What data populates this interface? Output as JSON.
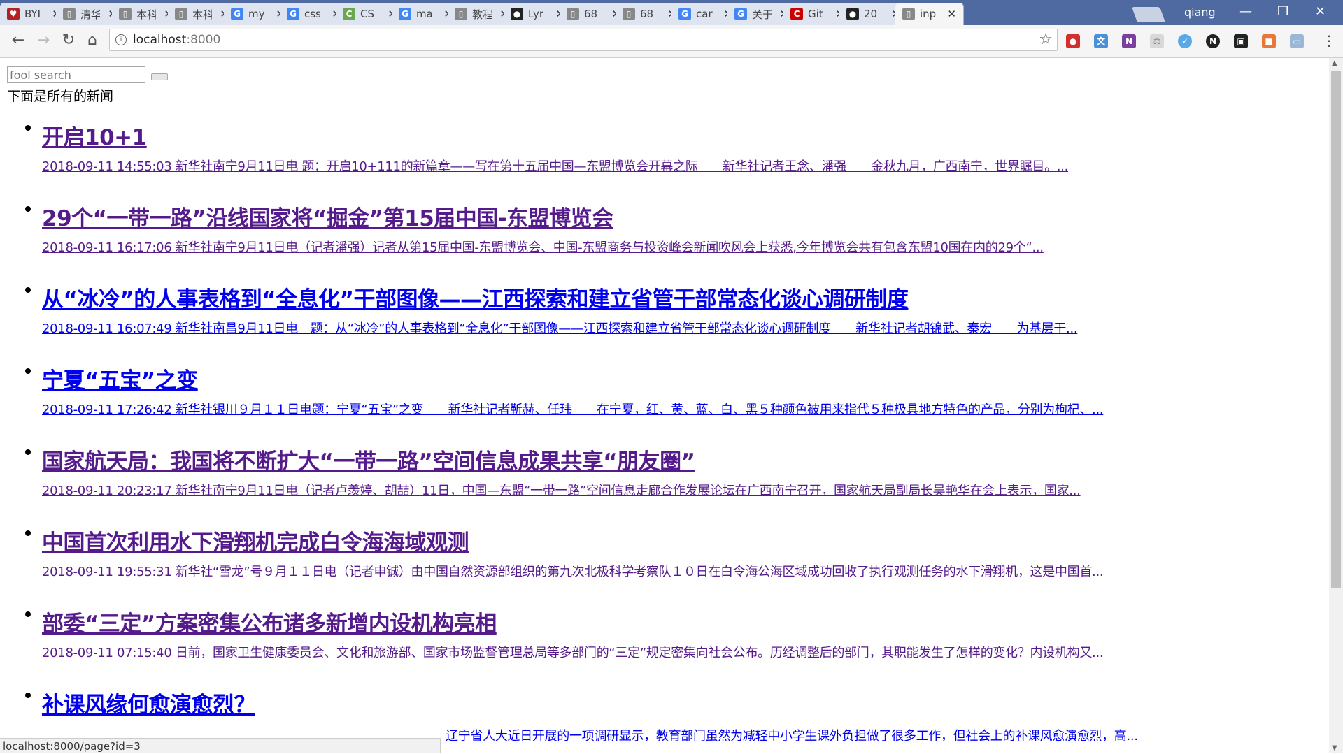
{
  "tabs": [
    {
      "label": "BYI",
      "icon": "bird-icon",
      "color": "#b22222"
    },
    {
      "label": "清华",
      "icon": "page-icon",
      "color": "#888888"
    },
    {
      "label": "本科",
      "icon": "page-icon",
      "color": "#888888"
    },
    {
      "label": "本科",
      "icon": "page-icon",
      "color": "#888888"
    },
    {
      "label": "my",
      "icon": "google-icon",
      "color": "#4285f4"
    },
    {
      "label": "css",
      "icon": "google-icon",
      "color": "#4285f4"
    },
    {
      "label": "CS",
      "icon": "csdn-icon",
      "color": "#6aa84f"
    },
    {
      "label": "ma",
      "icon": "google-icon",
      "color": "#4285f4"
    },
    {
      "label": "教程",
      "icon": "page-icon",
      "color": "#888888"
    },
    {
      "label": "Lyr",
      "icon": "github-icon",
      "color": "#222222"
    },
    {
      "label": "68",
      "icon": "page-icon",
      "color": "#888888"
    },
    {
      "label": "68",
      "icon": "page-icon",
      "color": "#888888"
    },
    {
      "label": "car",
      "icon": "google-icon",
      "color": "#4285f4"
    },
    {
      "label": "关于",
      "icon": "google-icon",
      "color": "#4285f4"
    },
    {
      "label": "Git",
      "icon": "c-icon",
      "color": "#cc0000"
    },
    {
      "label": "20",
      "icon": "github-icon",
      "color": "#222222"
    },
    {
      "label": "inp",
      "icon": "page-icon",
      "color": "#888888"
    }
  ],
  "user_name": "qiang",
  "address": {
    "host": "localhost",
    "port": ":8000"
  },
  "search": {
    "placeholder": "fool search"
  },
  "intro": "下面是所有的新闻",
  "news": [
    {
      "title": "开启10+1",
      "summary": "2018-09-11 14:55:03 新华社南宁9月11日电 题：开启10+111的新篇章——写在第十五届中国—东盟博览会开幕之际　　新华社记者王念、潘强　　金秋九月，广西南宁，世界瞩目。...",
      "visited": true
    },
    {
      "title": "29个“一带一路”沿线国家将“掘金”第15届中国-东盟博览会",
      "summary": "2018-09-11 16:17:06 新华社南宁9月11日电（记者潘强）记者从第15届中国-东盟博览会、中国-东盟商务与投资峰会新闻吹风会上获悉,今年博览会共有包含东盟10国在内的29个“...",
      "visited": true
    },
    {
      "title": "从“冰冷”的人事表格到“全息化”干部图像——江西探索和建立省管干部常态化谈心调研制度",
      "summary": "2018-09-11 16:07:49 新华社南昌9月11日电　题：从“冰冷”的人事表格到“全息化”干部图像——江西探索和建立省管干部常态化谈心调研制度　　新华社记者胡锦武、秦宏　　为基层干...",
      "visited": false
    },
    {
      "title": "宁夏“五宝”之变",
      "summary": "2018-09-11 17:26:42 新华社银川９月１１日电题：宁夏“五宝”之变　　新华社记者靳赫、任玮　　在宁夏，红、黄、蓝、白、黑５种颜色被用来指代５种极具地方特色的产品，分别为枸杞、...",
      "visited": false
    },
    {
      "title": "国家航天局：我国将不断扩大“一带一路”空间信息成果共享“朋友圈”",
      "summary": "2018-09-11 20:23:17 新华社南宁9月11日电（记者卢羡婷、胡喆）11日，中国—东盟“一带一路”空间信息走廊合作发展论坛在广西南宁召开，国家航天局副局长吴艳华在会上表示，国家...",
      "visited": true
    },
    {
      "title": "中国首次利用水下滑翔机完成白令海海域观测",
      "summary": "2018-09-11 19:55:31 新华社“雪龙”号９月１１日电（记者申铖）由中国自然资源部组织的第九次北极科学考察队１０日在白令海公海区域成功回收了执行观测任务的水下滑翔机，这是中国首...",
      "visited": true
    },
    {
      "title": "部委“三定”方案密集公布诸多新增内设机构亮相",
      "summary": "2018-09-11 07:15:40 日前，国家卫生健康委员会、文化和旅游部、国家市场监督管理总局等多部门的“三定”规定密集向社会公布。历经调整后的部门，其职能发生了怎样的变化？内设机构又...",
      "visited": true
    },
    {
      "title": "补课风缘何愈演愈烈？",
      "summary": "辽宁省人大近日开展的一项调研显示，教育部门虽然为减轻中小学生课外负担做了很多工作，但社会上的补课风愈演愈烈，高...",
      "visited": false
    }
  ],
  "status_url": "localhost:8000/page?id=3"
}
